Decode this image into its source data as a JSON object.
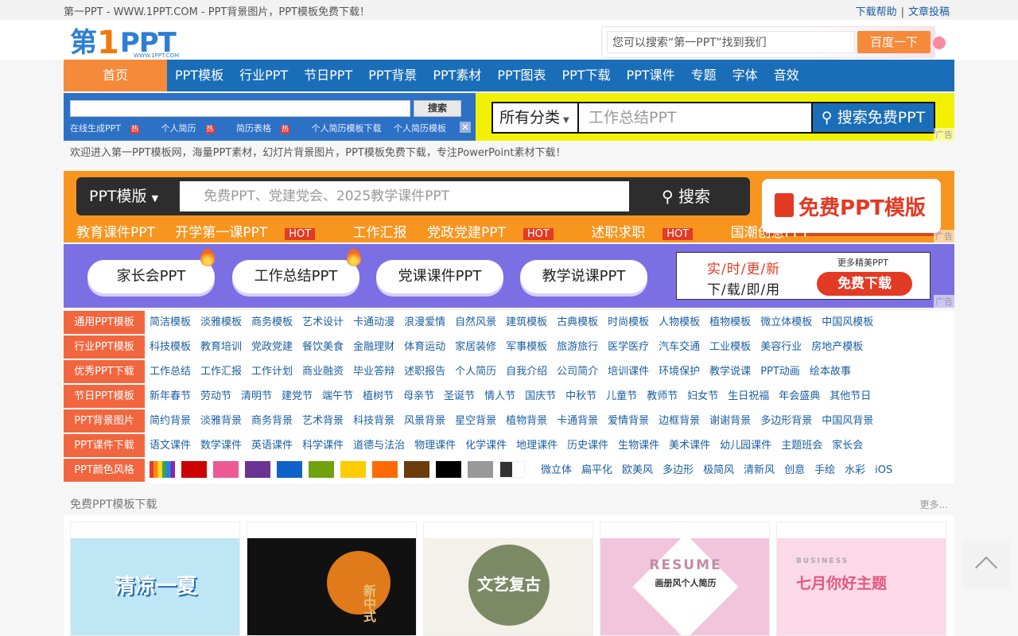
{
  "topbar": {
    "title": "第一PPT - WWW.1PPT.COM - PPT背景图片，PPT模板免费下载！",
    "help": "下载帮助",
    "sep": "|",
    "submit": "文章投稿"
  },
  "logo": {
    "text1": "第",
    "text2": "1",
    "text3": "PPT",
    "sub": "WWW.1PPT.COM"
  },
  "header_search": {
    "placeholder": "您可以搜索“第一PPT”找到我们",
    "button": "百度一下"
  },
  "nav": [
    "首页",
    "PPT模板",
    "行业PPT",
    "节日PPT",
    "PPT背景",
    "PPT素材",
    "PPT图表",
    "PPT下载",
    "PPT课件",
    "专题",
    "字体",
    "音效"
  ],
  "ad1": {
    "search_button": "搜索",
    "links": [
      "在线生成PPT",
      "个人简历",
      "简历表格",
      "个人简历模板下载",
      "个人简历模板"
    ],
    "hot": "热",
    "close": "✕",
    "ad_mark": "广告",
    "category": "所有分类",
    "placeholder": "工作总结PPT",
    "go": "搜索免费PPT"
  },
  "welcome": "欢迎进入第一PPT模板网，海量PPT素材，幻灯片背景图片，PPT模板免费下载，专注PowerPoint素材下载！",
  "ad2": {
    "category": "PPT模版",
    "placeholder": "免费PPT、党建党会、2025教学课件PPT",
    "search": "搜索",
    "free": "免费PPT模版",
    "hot": "HOT",
    "tags": [
      "教育课件PPT",
      "开学第一课PPT",
      "工作汇报",
      "党政党建PPT",
      "述职求职",
      "国潮创意PPT"
    ],
    "ad_mark": "广告"
  },
  "ad3": {
    "pills": [
      "家长会PPT",
      "工作总结PPT",
      "党课课件PPT",
      "教学说课PPT"
    ],
    "line1": "实/时/更/新",
    "line2": "下/载/即/用",
    "more": "更多精美PPT",
    "download": "免费下载",
    "ad_mark": "广告"
  },
  "categories": [
    {
      "label": "通用PPT模板",
      "links": [
        "简洁模板",
        "淡雅模板",
        "商务模板",
        "艺术设计",
        "卡通动漫",
        "浪漫爱情",
        "自然风景",
        "建筑模板",
        "古典模板",
        "时尚模板",
        "人物模板",
        "植物模板",
        "微立体模板",
        "中国风模板"
      ]
    },
    {
      "label": "行业PPT模板",
      "links": [
        "科技模板",
        "教育培训",
        "党政党建",
        "餐饮美食",
        "金融理财",
        "体育运动",
        "家居装修",
        "军事模板",
        "旅游旅行",
        "医学医疗",
        "汽车交通",
        "工业模板",
        "美容行业",
        "房地产模板"
      ]
    },
    {
      "label": "优秀PPT下载",
      "links": [
        "工作总结",
        "工作汇报",
        "工作计划",
        "商业融资",
        "毕业答辩",
        "述职报告",
        "个人简历",
        "自我介绍",
        "公司简介",
        "培训课件",
        "环境保护",
        "教学说课",
        "PPT动画",
        "绘本故事"
      ]
    },
    {
      "label": "节日PPT模板",
      "links": [
        "新年春节",
        "劳动节",
        "清明节",
        "建党节",
        "端午节",
        "植树节",
        "母亲节",
        "圣诞节",
        "情人节",
        "国庆节",
        "中秋节",
        "儿童节",
        "教师节",
        "妇女节",
        "生日祝福",
        "年会盛典",
        "其他节日"
      ]
    },
    {
      "label": "PPT背景图片",
      "links": [
        "简约背景",
        "淡雅背景",
        "商务背景",
        "艺术背景",
        "科技背景",
        "风景背景",
        "星空背景",
        "植物背景",
        "卡通背景",
        "爱情背景",
        "边框背景",
        "谢谢背景",
        "多边形背景",
        "中国风背景"
      ]
    },
    {
      "label": "PPT课件下载",
      "links": [
        "语文课件",
        "数学课件",
        "英语课件",
        "科学课件",
        "道德与法治",
        "物理课件",
        "化学课件",
        "地理课件",
        "历史课件",
        "生物课件",
        "美术课件",
        "幼儿园课件",
        "主题班会",
        "家长会"
      ]
    },
    {
      "label": "PPT颜色风格",
      "links": [
        "微立体",
        "扁平化",
        "欧美风",
        "多边形",
        "极简风",
        "清新风",
        "创意",
        "手绘",
        "水彩",
        "iOS"
      ]
    }
  ],
  "colors": [
    "#cc0000",
    "#ee5a96",
    "#6a3394",
    "#0f63c8",
    "#6ea30e",
    "#ffcc00",
    "#ff6a00",
    "#6b3b0c",
    "#000000",
    "#999999"
  ],
  "free_section": {
    "title": "免费PPT模板下载",
    "more": "更多..."
  },
  "cards": [
    {
      "caption": "清凉一夏",
      "subcaption": "",
      "bg": "#bfe6f5"
    },
    {
      "caption": "新中式",
      "subcaption": "",
      "bg": "#111111"
    },
    {
      "caption": "文艺复古",
      "subcaption": "",
      "bg": "#f4f1ea"
    },
    {
      "caption": "RESUME",
      "subcaption": "画册风个人简历",
      "bg": "#f1c6dc"
    },
    {
      "caption": "七月你好主题",
      "subcaption": "BUSINESS",
      "bg": "#fbd9e6"
    }
  ]
}
